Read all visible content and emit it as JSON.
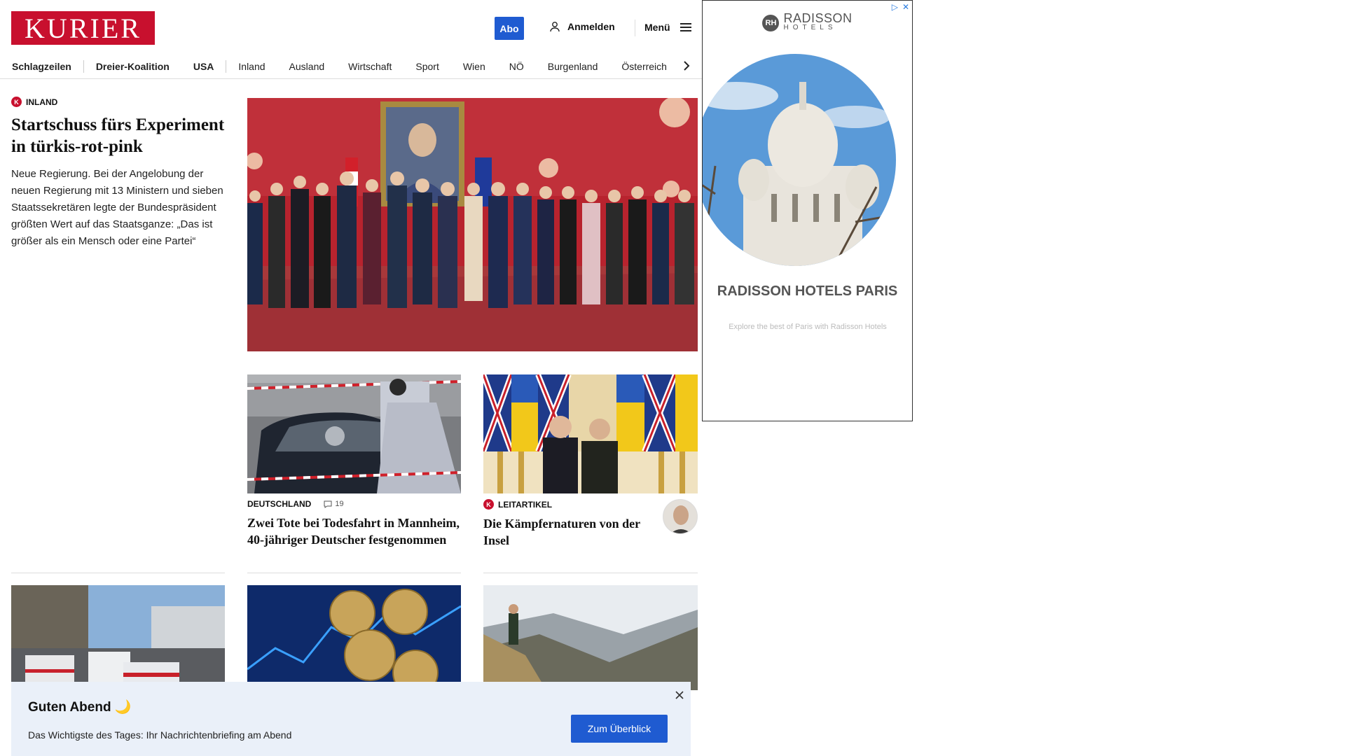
{
  "header": {
    "logo": "KURIER",
    "abo_label": "Abo",
    "login_label": "Anmelden",
    "menu_label": "Menü"
  },
  "nav": {
    "items": [
      "Schlagzeilen",
      "Dreier-Koalition",
      "USA",
      "Inland",
      "Ausland",
      "Wirtschaft",
      "Sport",
      "Wien",
      "NÖ",
      "Burgenland",
      "Österreich"
    ]
  },
  "lead": {
    "kicker": "INLAND",
    "title": "Startschuss fürs Experiment in türkis-rot-pink",
    "teaser": "Neue Regierung. Bei der Angelobung der neuen Regierung mit 13 Ministern und sieben Staatssekretären legte der Bundespräsident größten Wert auf das Staatsganze: „Das ist größer als ein Mensch oder eine Partei“"
  },
  "cards": [
    {
      "kicker": "DEUTSCHLAND",
      "comments": "19",
      "title": "Zwei Tote bei Todesfahrt in Mannheim, 40-jähriger Deutscher festgenommen"
    },
    {
      "kicker": "LEITARTIKEL",
      "title": "Die Kämpfernaturen von der Insel"
    }
  ],
  "ad": {
    "brand": "RADISSON",
    "brand_sub": "HOTELS",
    "brand_mark": "RH",
    "title": "RADISSON HOTELS PARIS",
    "subtitle": "Explore the best of Paris with Radisson Hotels"
  },
  "banner": {
    "title": "Guten Abend 🌙",
    "text": "Das Wichtigste des Tages: Ihr Nachrichtenbriefing am Abend",
    "button": "Zum Überblick"
  },
  "colors": {
    "brand": "#c8102e",
    "accent": "#1f5bd1",
    "banner_bg": "#eaf0f9"
  }
}
